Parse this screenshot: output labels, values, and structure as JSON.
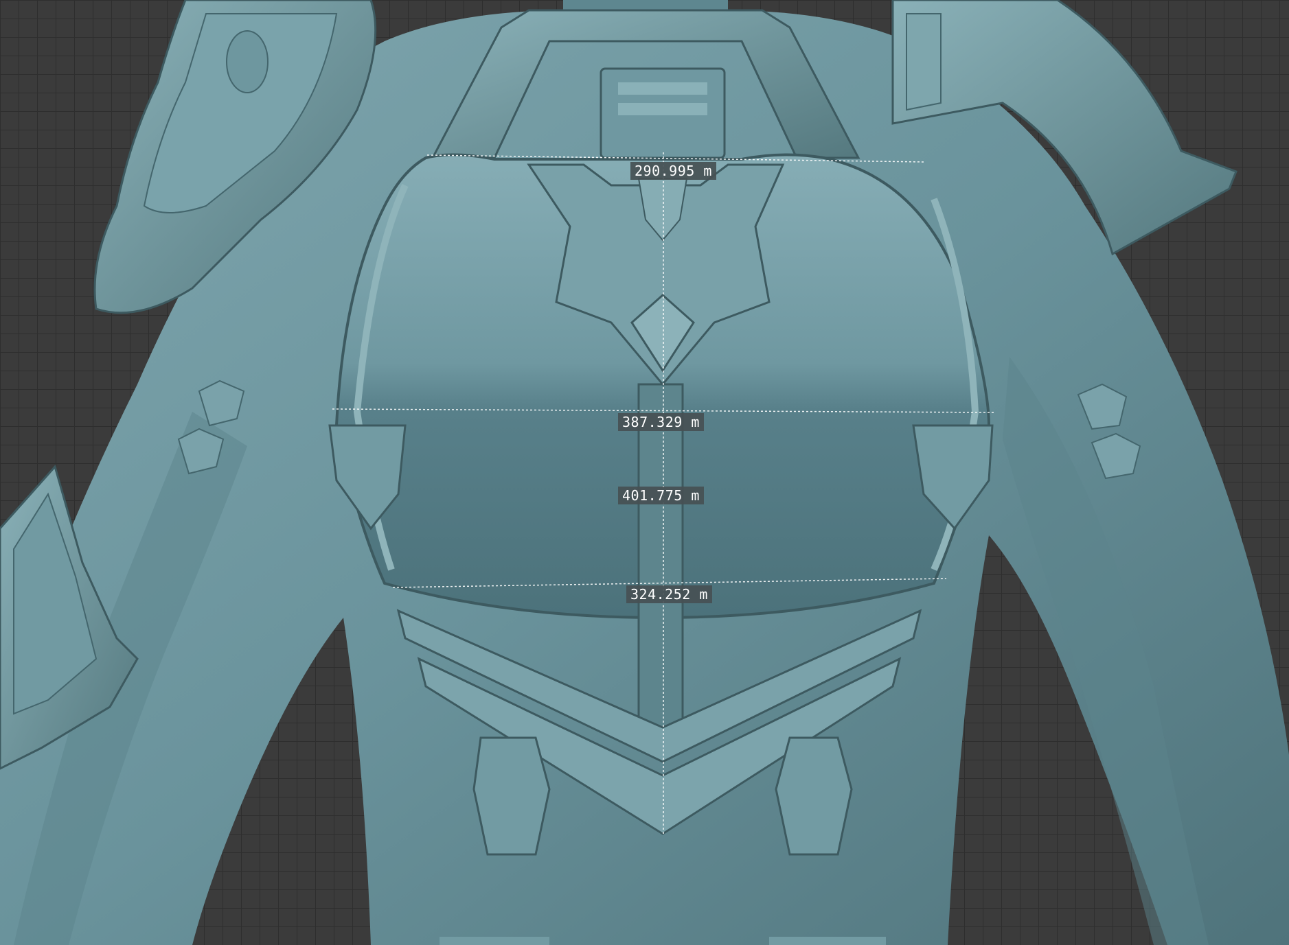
{
  "viewport": {
    "mesh_color": "#6a939c",
    "background_color": "#3b3b3b",
    "grid_color": "#2e2e2e"
  },
  "measurements": {
    "top_width": "290.995 m",
    "chest_width": "387.329 m",
    "vertical_length": "401.775 m",
    "lower_width": "324.252 m"
  }
}
